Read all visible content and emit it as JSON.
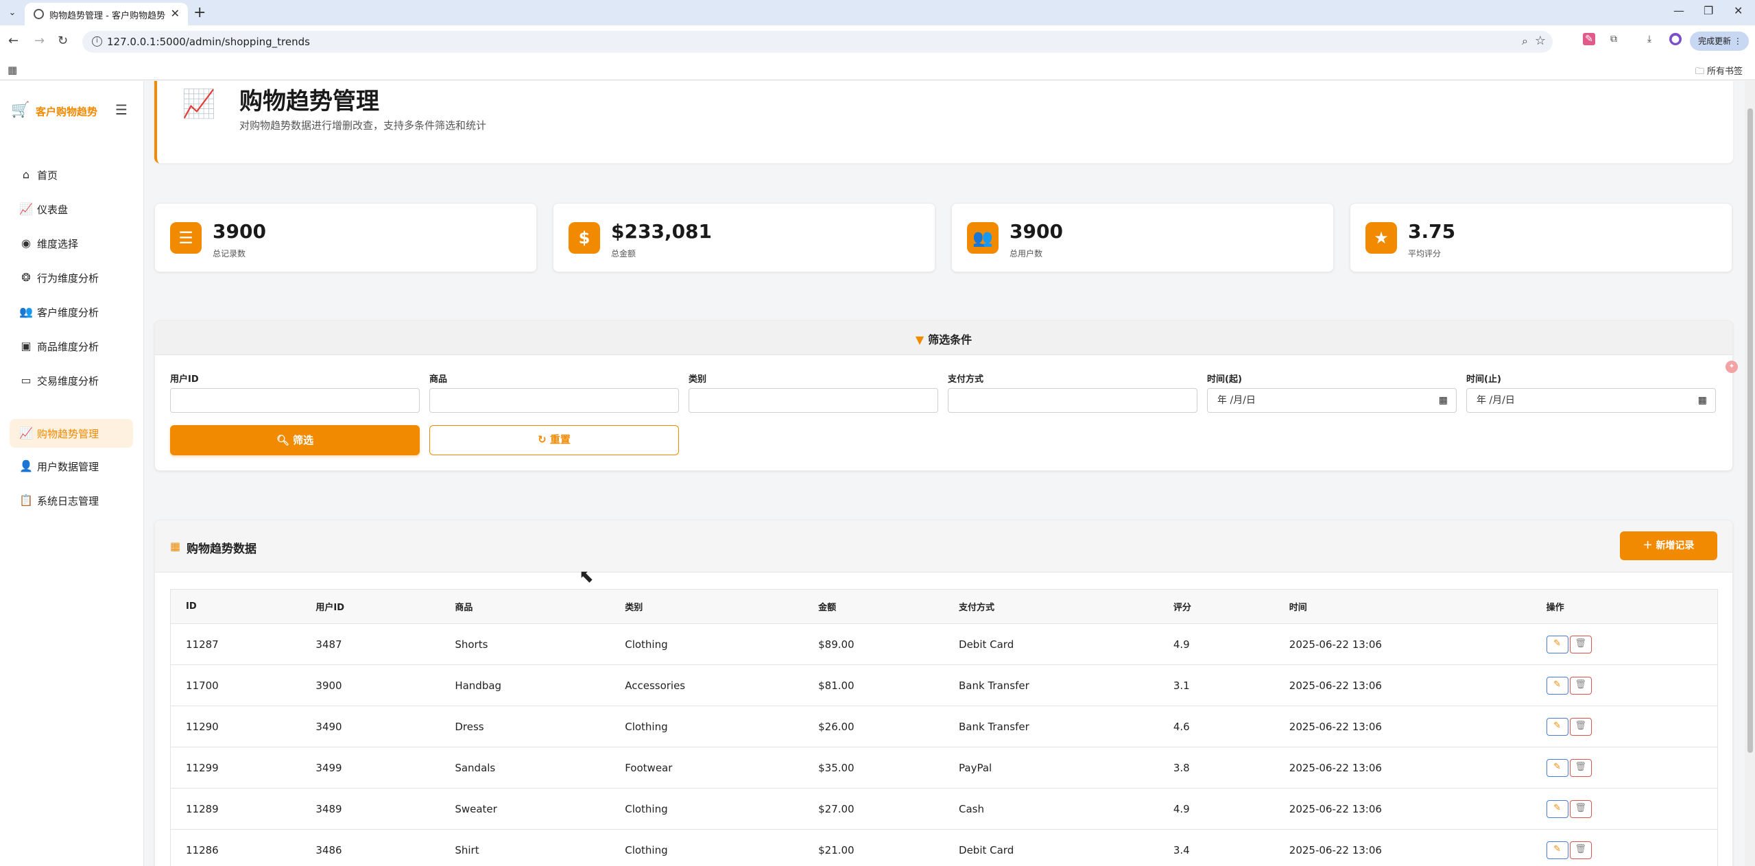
{
  "browser": {
    "tab_title": "购物趋势管理 - 客户购物趋势",
    "url": "127.0.0.1:5000/admin/shopping_trends",
    "update_label": "完成更新",
    "bookmarks_label": "所有书签"
  },
  "sidebar": {
    "brand": "客户购物趋势",
    "items": [
      {
        "label": "首页",
        "icon": "home-icon",
        "glyph": "⌂",
        "active": false
      },
      {
        "label": "仪表盘",
        "icon": "chart-line-icon",
        "glyph": "📈",
        "active": false
      },
      {
        "label": "维度选择",
        "icon": "compass-icon",
        "glyph": "◉",
        "active": false
      },
      {
        "label": "行为维度分析",
        "icon": "brain-icon",
        "glyph": "❂",
        "active": false
      },
      {
        "label": "客户维度分析",
        "icon": "users-icon",
        "glyph": "👥",
        "active": false
      },
      {
        "label": "商品维度分析",
        "icon": "box-icon",
        "glyph": "▣",
        "active": false
      },
      {
        "label": "交易维度分析",
        "icon": "credit-card-icon",
        "glyph": "▭",
        "active": false
      },
      {
        "label": "购物趋势管理",
        "icon": "chart-line-icon",
        "glyph": "📈",
        "active": true
      },
      {
        "label": "用户数据管理",
        "icon": "user-cog-icon",
        "glyph": "👤",
        "active": false
      },
      {
        "label": "系统日志管理",
        "icon": "clipboard-icon",
        "glyph": "📋",
        "active": false
      }
    ]
  },
  "header": {
    "title": "购物趋势管理",
    "subtitle": "对购物趋势数据进行增删改查，支持多条件筛选和统计"
  },
  "stats": [
    {
      "value": "3900",
      "label": "总记录数",
      "icon": "database-icon",
      "glyph": "☰"
    },
    {
      "value": "$233,081",
      "label": "总金额",
      "icon": "dollar-icon",
      "glyph": "$"
    },
    {
      "value": "3900",
      "label": "总用户数",
      "icon": "users-icon",
      "glyph": "👥"
    },
    {
      "value": "3.75",
      "label": "平均评分",
      "icon": "star-icon",
      "glyph": "★"
    }
  ],
  "filter": {
    "title": "筛选条件",
    "fields": [
      {
        "label": "用户ID",
        "value": ""
      },
      {
        "label": "商品",
        "value": ""
      },
      {
        "label": "类别",
        "value": ""
      },
      {
        "label": "支付方式",
        "value": ""
      },
      {
        "label": "时间(起)",
        "value": "年 /月/日"
      },
      {
        "label": "时间(止)",
        "value": "年 /月/日"
      }
    ],
    "filter_button": "筛选",
    "reset_button": "重置"
  },
  "table": {
    "title": "购物趋势数据",
    "add_button": "新增记录",
    "columns": [
      "ID",
      "用户ID",
      "商品",
      "类别",
      "金额",
      "支付方式",
      "评分",
      "时间",
      "操作"
    ],
    "rows": [
      [
        "11287",
        "3487",
        "Shorts",
        "Clothing",
        "$89.00",
        "Debit Card",
        "4.9",
        "2025-06-22 13:06"
      ],
      [
        "11700",
        "3900",
        "Handbag",
        "Accessories",
        "$81.00",
        "Bank Transfer",
        "3.1",
        "2025-06-22 13:06"
      ],
      [
        "11290",
        "3490",
        "Dress",
        "Clothing",
        "$26.00",
        "Bank Transfer",
        "4.6",
        "2025-06-22 13:06"
      ],
      [
        "11299",
        "3499",
        "Sandals",
        "Footwear",
        "$35.00",
        "PayPal",
        "3.8",
        "2025-06-22 13:06"
      ],
      [
        "11289",
        "3489",
        "Sweater",
        "Clothing",
        "$27.00",
        "Cash",
        "4.9",
        "2025-06-22 13:06"
      ],
      [
        "11286",
        "3486",
        "Shirt",
        "Clothing",
        "$21.00",
        "Debit Card",
        "3.4",
        "2025-06-22 13:06"
      ]
    ]
  },
  "colors": {
    "accent": "#f28a00",
    "edit_border": "#4a7bd8",
    "delete_border": "#d9534f"
  }
}
